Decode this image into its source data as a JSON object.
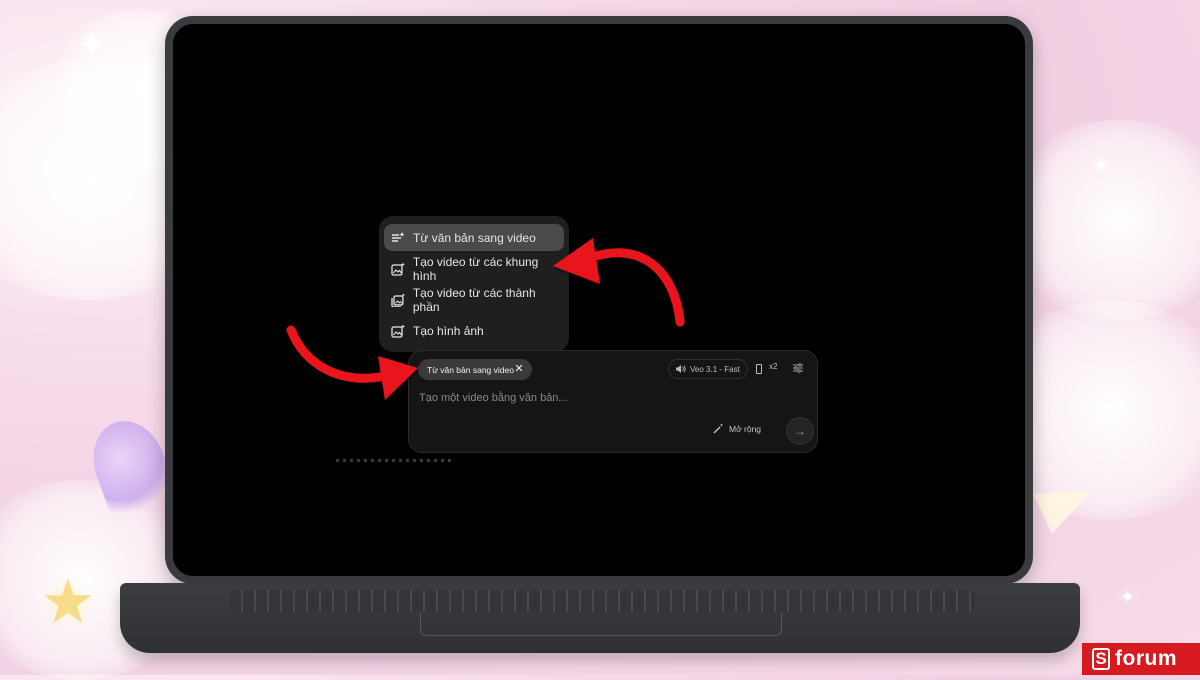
{
  "menu": {
    "items": [
      {
        "label": "Từ văn bản sang video",
        "icon": "text-lines-sparkle-icon",
        "active": true
      },
      {
        "label": "Tạo video từ các khung hình",
        "icon": "image-sparkle-icon",
        "active": false
      },
      {
        "label": "Tạo video từ các thành phần",
        "icon": "stacked-images-sparkle-icon",
        "active": false
      },
      {
        "label": "Tạo hình ảnh",
        "icon": "image-sparkle-icon",
        "active": false
      }
    ]
  },
  "composer": {
    "mode_chip": "Từ văn bản sang video",
    "model": "Veo 3.1 - Fast",
    "output_count": "x2",
    "placeholder": "Tạo một video bằng văn bản...",
    "expand_label": "Mở rộng"
  },
  "watermark": {
    "brand": "forum",
    "brand_mark": "S"
  },
  "colors": {
    "arrow": "#e8141a",
    "brand": "#d71920",
    "screen": "#000000",
    "laptop": "#3a3b3f"
  }
}
